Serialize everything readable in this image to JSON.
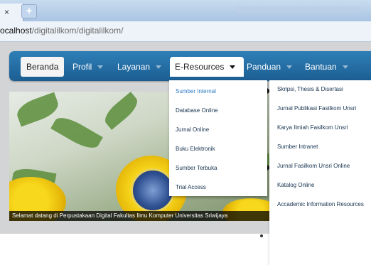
{
  "browser": {
    "tab_close_glyph": "×",
    "new_tab_glyph": "+",
    "url_prefix": "ocalhost",
    "url_rest": "/digitalilkom/digitalilkom/"
  },
  "nav": {
    "items": [
      {
        "label": "Beranda"
      },
      {
        "label": "Profil"
      },
      {
        "label": "Layanan"
      },
      {
        "label": "E-Resources"
      },
      {
        "label": "Panduan"
      },
      {
        "label": "Bantuan"
      }
    ]
  },
  "eresources_menu": {
    "items": [
      {
        "label": "Sumber Internal"
      },
      {
        "label": "Database Online"
      },
      {
        "label": "Jurnal Online"
      },
      {
        "label": "Buku Elektronik"
      },
      {
        "label": "Sumber Terbuka"
      },
      {
        "label": "Trial Access"
      }
    ]
  },
  "internal_submenu": {
    "items": [
      {
        "label": "Skripsi, Thesis & Disertasi"
      },
      {
        "label": "Jurnal Publikasi Fasilkom Unsri"
      },
      {
        "label": "Karya Ilmiah Fasilkom Unsri"
      },
      {
        "label": "Sumber Intranet"
      },
      {
        "label": "Jurnal Fasilkom Unsri Online"
      },
      {
        "label": "Katalog Online"
      },
      {
        "label": "Accademic Information Resources"
      }
    ]
  },
  "slider": {
    "caption": "Selamat datang di Perpustakaan Digital Fakultas Ilmu Komputer Universitas Sriwijaya",
    "slide_count": 5,
    "active_slide": 2
  },
  "colors": {
    "nav_blue": "#1b5e92",
    "menu_highlight": "#2b7bc2",
    "menu_text": "#16334f"
  }
}
